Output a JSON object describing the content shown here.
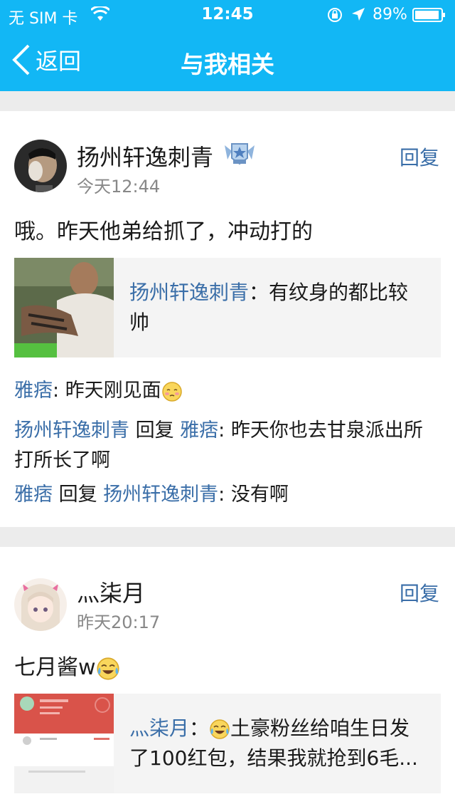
{
  "status": {
    "carrier": "无 SIM 卡",
    "time": "12:45",
    "battery": "89%"
  },
  "nav": {
    "back_label": "返回",
    "title": "与我相关"
  },
  "posts": [
    {
      "username": "扬州轩逸刺青",
      "time": "今天12:44",
      "reply_label": "回复",
      "text": "哦。昨天他弟给抓了，冲动打的",
      "quote_name": "扬州轩逸刺青",
      "quote_sep": "：",
      "quote_text": "有纹身的都比较帅",
      "comments": [
        {
          "name": "雅痞",
          "sep": ": ",
          "text": "昨天刚见面"
        },
        {
          "name": "扬州轩逸刺青",
          "mid": " 回复 ",
          "name2": "雅痞",
          "sep": ": ",
          "text": "昨天你也去甘泉派出所打所长了啊"
        },
        {
          "name": "雅痞",
          "mid": " 回复 ",
          "name2": "扬州轩逸刺青",
          "sep": ": ",
          "text": "没有啊"
        }
      ]
    },
    {
      "username": "灬柒月",
      "time": "昨天20:17",
      "reply_label": "回复",
      "text": "七月酱w",
      "quote_name": "灬柒月",
      "quote_sep": "：",
      "quote_text": "土豪粉丝给咱生日发了100红包，结果我就抢到6毛..."
    }
  ],
  "colors": {
    "header": "#12b7f5",
    "link": "#3a6ea8"
  }
}
